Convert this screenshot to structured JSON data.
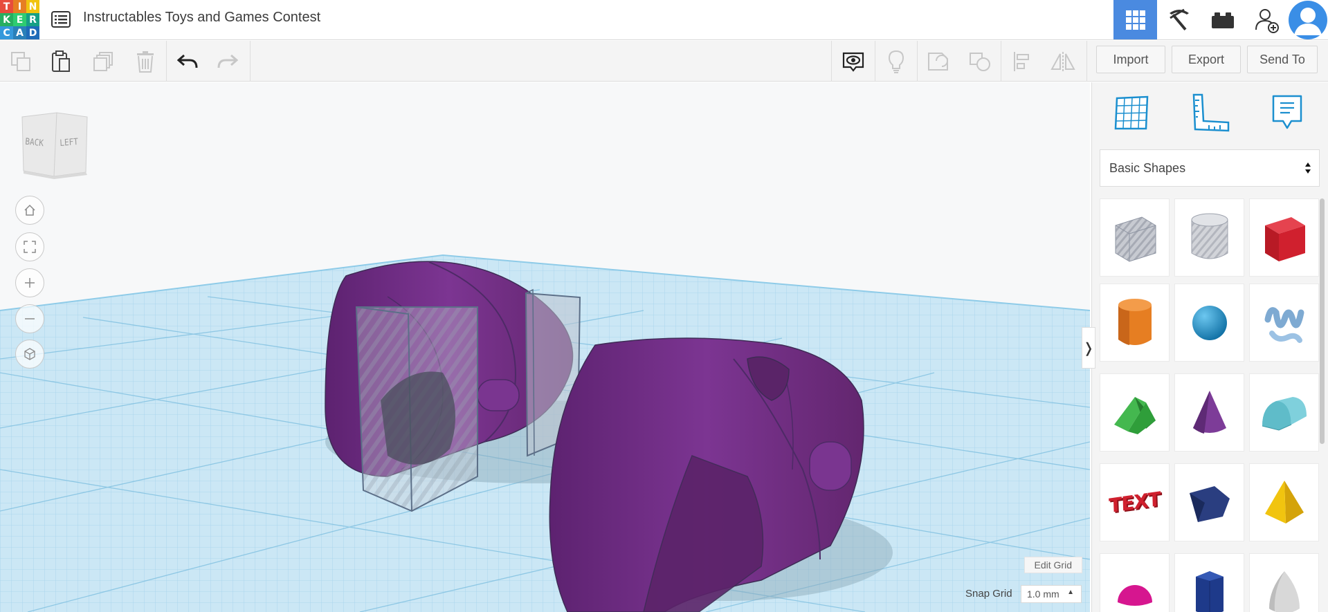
{
  "app": {
    "logo_letters": [
      "T",
      "I",
      "N",
      "K",
      "E",
      "R",
      "C",
      "A",
      "D"
    ],
    "logo_colors": [
      "#e74c3c",
      "#e67e22",
      "#f1c40f",
      "#27ae60",
      "#2ecc71",
      "#16a085",
      "#3498db",
      "#2980b9",
      "#1e6bb8"
    ],
    "title": "Instructables Toys and Games Contest"
  },
  "header_icons": [
    "grid-view-icon",
    "pickaxe-icon",
    "bricks-icon",
    "add-user-icon",
    "user-avatar-icon"
  ],
  "toolbar": {
    "import_label": "Import",
    "export_label": "Export",
    "sendto_label": "Send To"
  },
  "viewcube": {
    "back_label": "BACK",
    "left_label": "LEFT"
  },
  "grid": {
    "edit_label": "Edit Grid",
    "snap_label": "Snap Grid",
    "snap_value": "1.0 mm"
  },
  "panel": {
    "library": "Basic Shapes",
    "shapes": [
      {
        "name": "box-hole",
        "color": "#b9bcc4"
      },
      {
        "name": "cylinder-hole",
        "color": "#c8cad0"
      },
      {
        "name": "box",
        "color": "#d0202e"
      },
      {
        "name": "cylinder",
        "color": "#e67e22"
      },
      {
        "name": "sphere",
        "color": "#1991c9"
      },
      {
        "name": "scribble",
        "color": "#8fb6d8"
      },
      {
        "name": "roof",
        "color": "#2f9e3a"
      },
      {
        "name": "cone",
        "color": "#7d3c98"
      },
      {
        "name": "round-roof",
        "color": "#5fbcc9"
      },
      {
        "name": "text",
        "color": "#d0202e"
      },
      {
        "name": "wedge",
        "color": "#23356e"
      },
      {
        "name": "pyramid",
        "color": "#f1c40f"
      },
      {
        "name": "half-sphere",
        "color": "#d6168f"
      },
      {
        "name": "polygon",
        "color": "#1e3a8a"
      },
      {
        "name": "paraboloid",
        "color": "#cfcfcf"
      }
    ],
    "text_shape_label": "TEXT"
  }
}
